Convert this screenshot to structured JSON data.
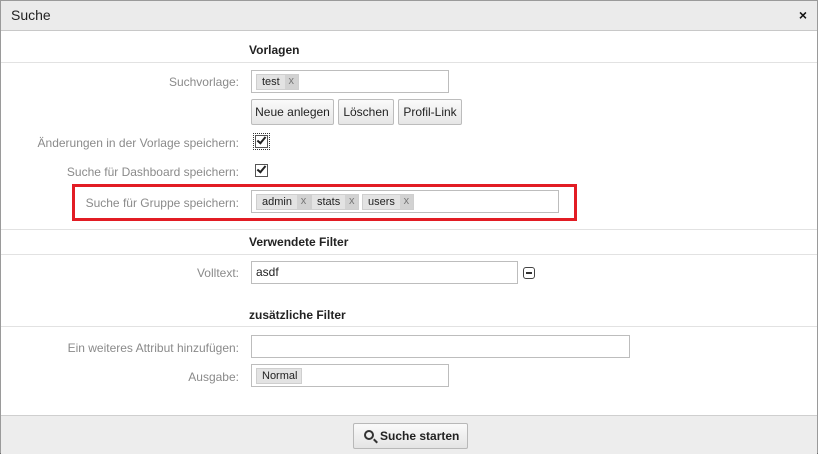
{
  "dialog": {
    "title": "Suche",
    "close_label": "×"
  },
  "sections": {
    "templates": "Vorlagen",
    "used_filters": "Verwendete Filter",
    "additional_filters": "zusätzliche Filter"
  },
  "template": {
    "label": "Suchvorlage:",
    "tag": "test",
    "buttons": {
      "new": "Neue anlegen",
      "delete": "Löschen",
      "profile_link": "Profil-Link"
    },
    "save_changes_label": "Änderungen in der Vorlage speichern:",
    "save_changes_checked": true,
    "save_dashboard_label": "Suche für Dashboard speichern:",
    "save_dashboard_checked": true,
    "save_group_label": "Suche für Gruppe speichern:",
    "group_tags": [
      "admin",
      "stats",
      "users"
    ]
  },
  "filters": {
    "fulltext_label": "Volltext:",
    "fulltext_value": "asdf"
  },
  "additional": {
    "add_attribute_label": "Ein weiteres Attribut hinzufügen:",
    "add_attribute_value": "",
    "output_label": "Ausgabe:",
    "output_tag": "Normal"
  },
  "footer": {
    "start_search": "Suche starten"
  },
  "tag_remove": "x",
  "colors": {
    "highlight": "#e21c24"
  }
}
